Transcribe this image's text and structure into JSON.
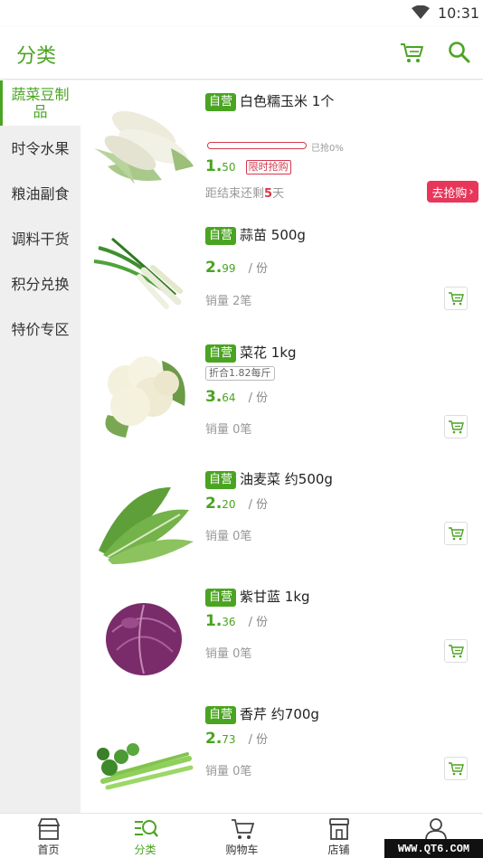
{
  "status": {
    "time": "10:31"
  },
  "header": {
    "title": "分类",
    "cart_icon": "cart-icon",
    "search_icon": "search-icon"
  },
  "colors": {
    "accent": "#4aa421",
    "flash": "#d43a4e",
    "grab": "#e8365a"
  },
  "sidebar": {
    "items": [
      {
        "label": "蔬菜豆制品",
        "active": true
      },
      {
        "label": "时令水果"
      },
      {
        "label": "粮油副食"
      },
      {
        "label": "调料干货"
      },
      {
        "label": "积分兑换"
      },
      {
        "label": "特价专区"
      }
    ]
  },
  "products": [
    {
      "tag": "自营",
      "name": "白色糯玉米 1个",
      "progress_text": "已抢0%",
      "progress": 0,
      "price_int": "1.",
      "price_dec": "50",
      "flash_label": "限时抢购",
      "countdown_prefix": "距结束还剩",
      "countdown_num": "5",
      "countdown_suffix": "天",
      "grab_label": "去抢购"
    },
    {
      "tag": "自营",
      "name": "蒜苗 500g",
      "price_int": "2.",
      "price_dec": "99",
      "unit": "/ 份",
      "sales": "销量 2笔"
    },
    {
      "tag": "自营",
      "name": "菜花 1kg",
      "discount": "折合1.82每斤",
      "price_int": "3.",
      "price_dec": "64",
      "unit": "/ 份",
      "sales": "销量 0笔"
    },
    {
      "tag": "自营",
      "name": "油麦菜  约500g",
      "price_int": "2.",
      "price_dec": "20",
      "unit": "/ 份",
      "sales": "销量 0笔"
    },
    {
      "tag": "自营",
      "name": "紫甘蓝 1kg",
      "price_int": "1.",
      "price_dec": "36",
      "unit": "/ 份",
      "sales": "销量 0笔"
    },
    {
      "tag": "自营",
      "name": "香芹  约700g",
      "price_int": "2.",
      "price_dec": "73",
      "unit": "/ 份",
      "sales": "销量 0笔"
    }
  ],
  "tabs": [
    {
      "label": "首页",
      "icon": "home-store-icon"
    },
    {
      "label": "分类",
      "icon": "category-icon",
      "active": true
    },
    {
      "label": "购物车",
      "icon": "cart-icon"
    },
    {
      "label": "店铺",
      "icon": "shop-icon"
    },
    {
      "label": "我的",
      "icon": "user-icon"
    }
  ],
  "watermark": "WWW.QT6.COM"
}
